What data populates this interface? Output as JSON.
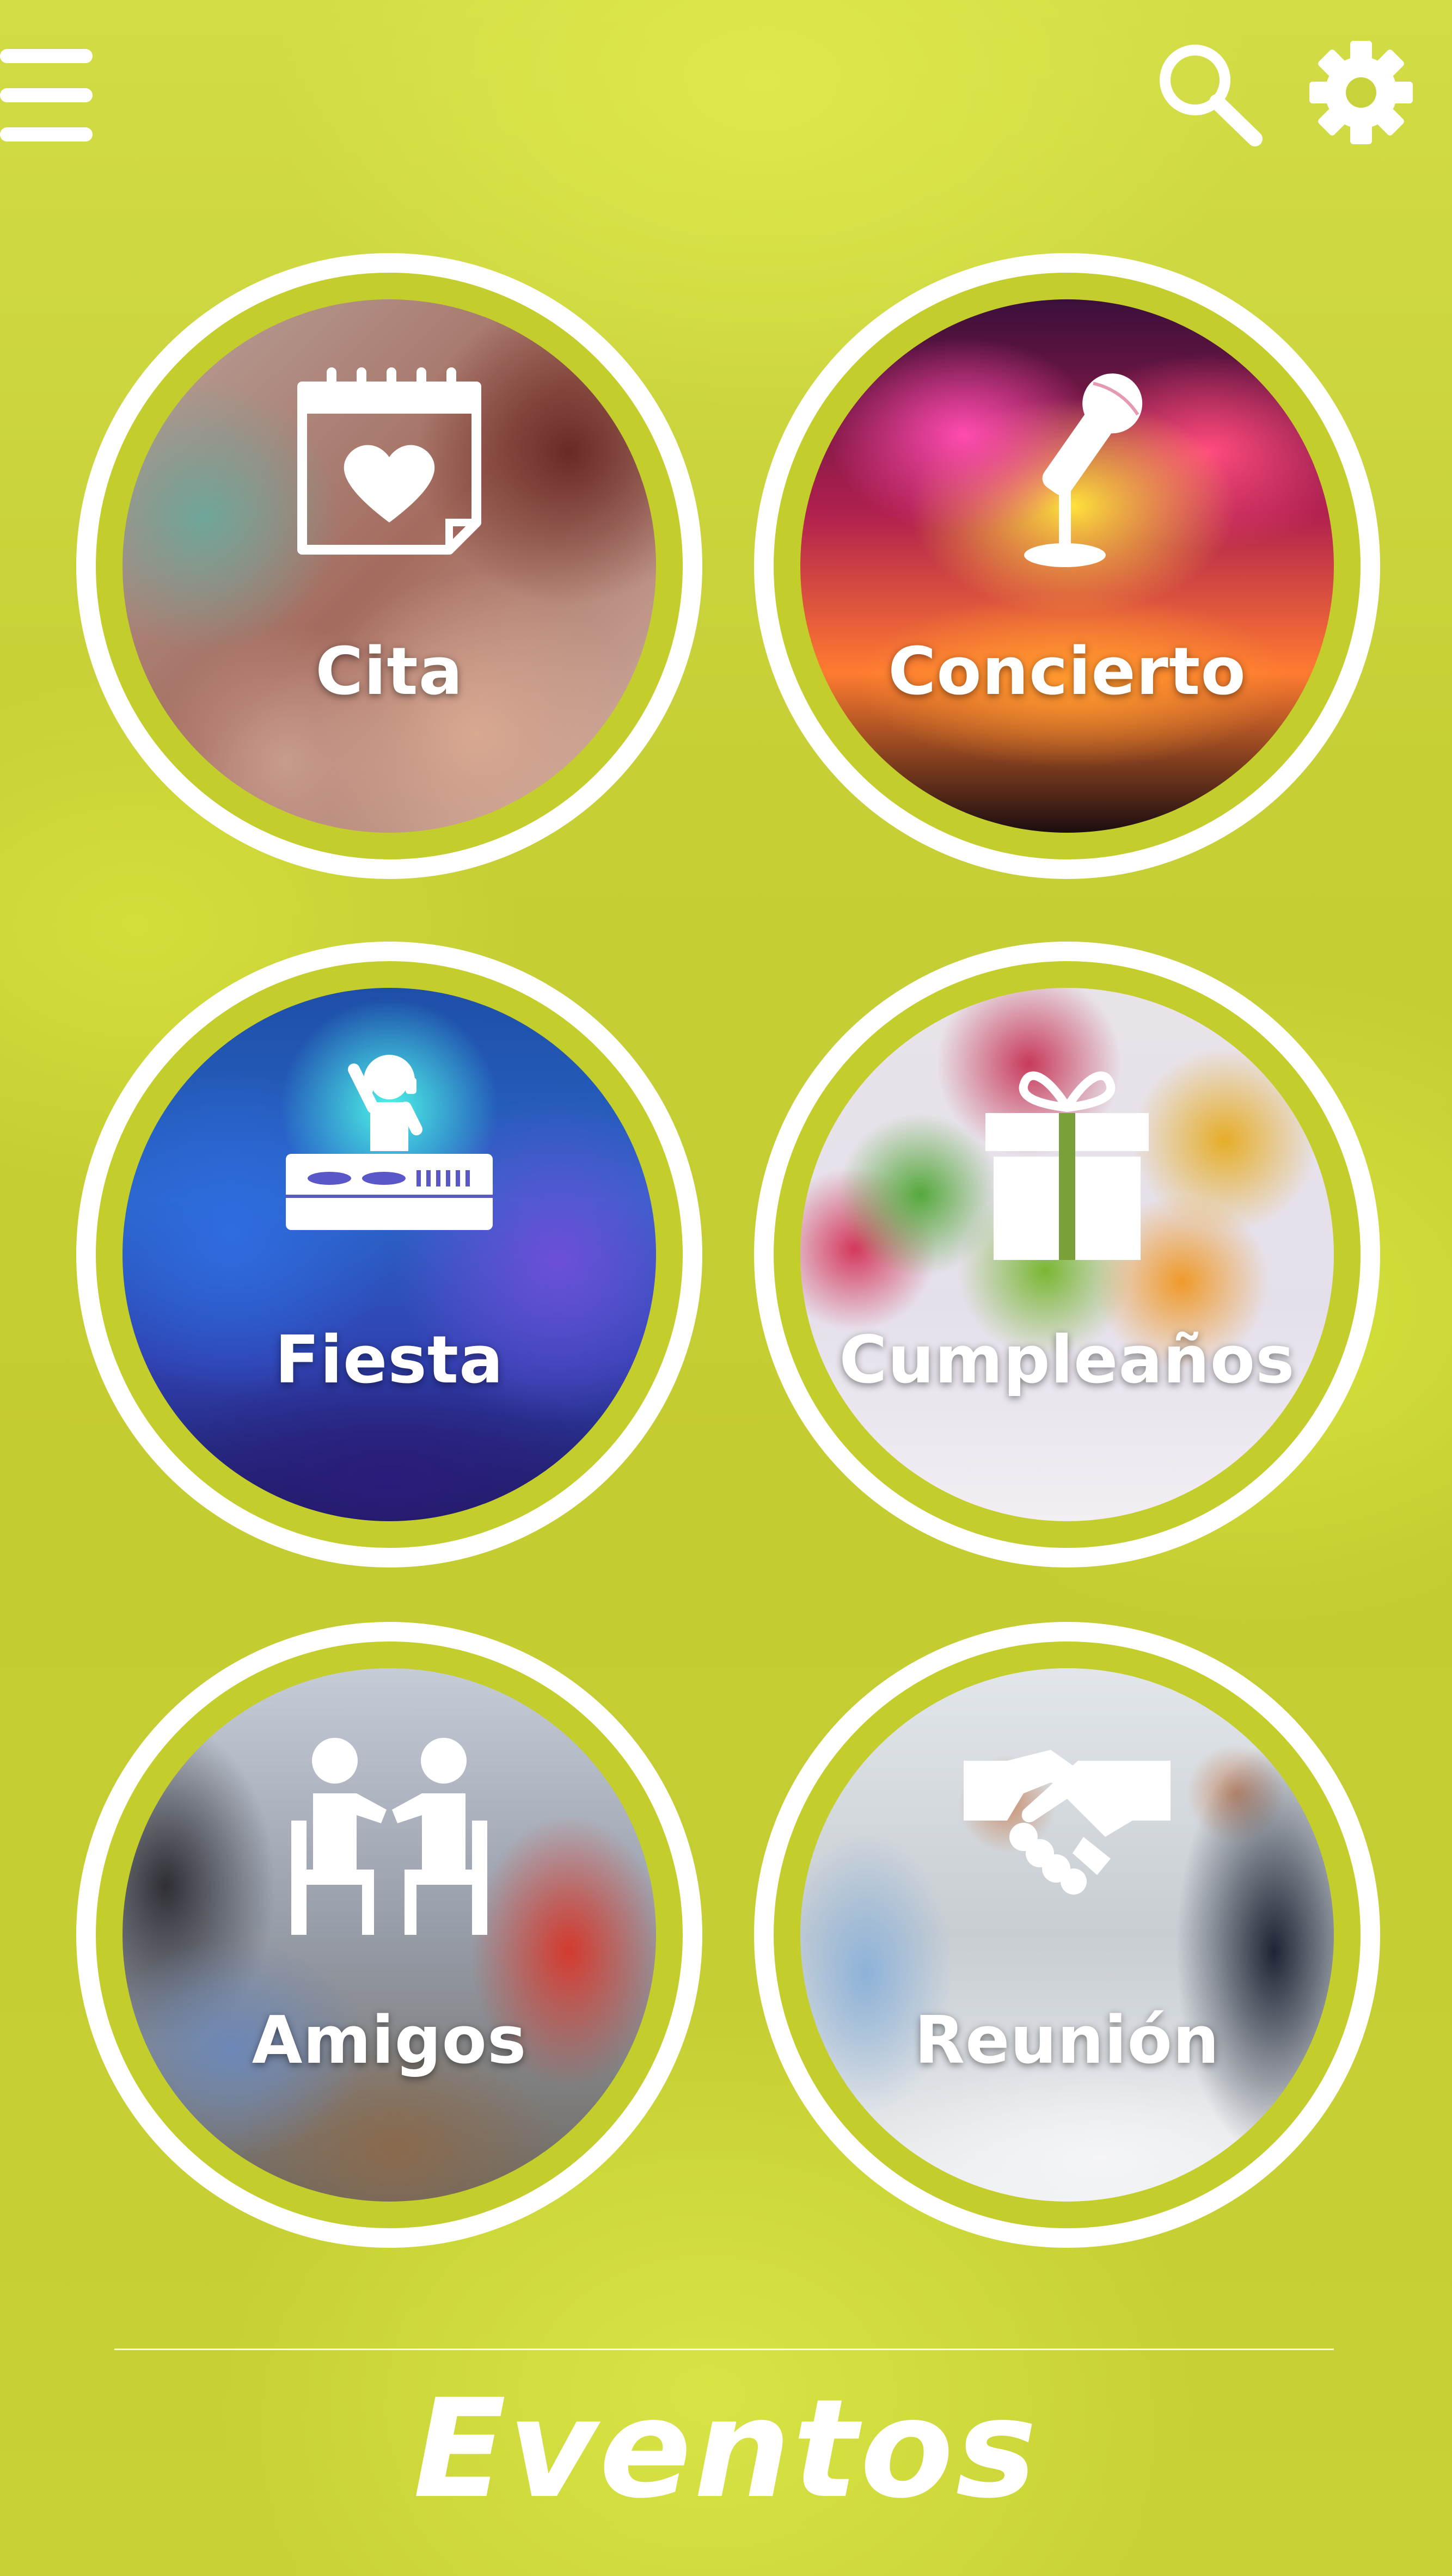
{
  "header": {
    "menu_icon": "hamburger-menu-icon",
    "search_icon": "search-icon",
    "settings_icon": "gear-icon"
  },
  "events": [
    {
      "label": "Cita",
      "icon": "calendar-heart-icon"
    },
    {
      "label": "Concierto",
      "icon": "microphone-icon"
    },
    {
      "label": "Fiesta",
      "icon": "dj-icon"
    },
    {
      "label": "Cumpleaños",
      "icon": "gift-icon"
    },
    {
      "label": "Amigos",
      "icon": "friends-talking-icon"
    },
    {
      "label": "Reunión",
      "icon": "handshake-icon"
    }
  ],
  "footer": {
    "title": "Eventos"
  },
  "colors": {
    "background": "#c6cf36",
    "ring": "#ffffff",
    "text": "#ffffff"
  }
}
